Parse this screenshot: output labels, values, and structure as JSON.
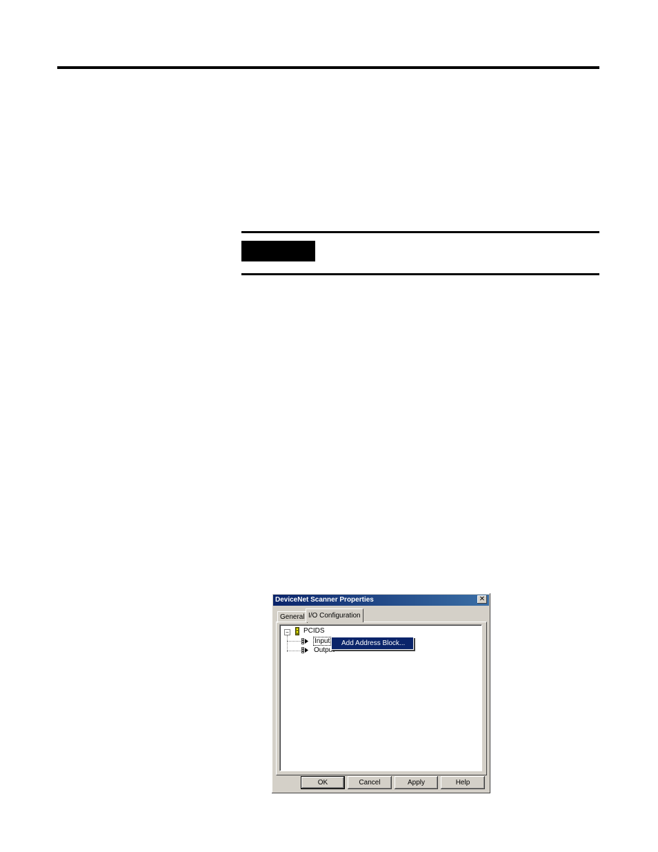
{
  "dialog": {
    "title": "DeviceNet Scanner Properties",
    "close_glyph": "✕",
    "tabs": [
      {
        "label": "General"
      },
      {
        "label": "I/O Configuration"
      }
    ],
    "tree": {
      "expander_glyph": "−",
      "root": "PCIDS",
      "children": [
        {
          "label": "Input"
        },
        {
          "label": "Output"
        }
      ]
    },
    "context_menu": {
      "item": "Add Address Block..."
    },
    "buttons": {
      "ok": "OK",
      "cancel": "Cancel",
      "apply": "Apply",
      "help": "Help"
    }
  },
  "colors": {
    "titlebar": "#0a246a",
    "dialog_bg": "#d4d0c8",
    "selection": "#0a246a"
  }
}
